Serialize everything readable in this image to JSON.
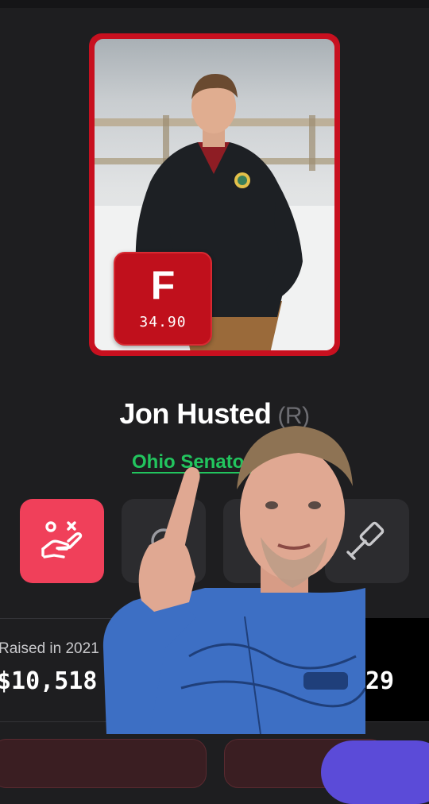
{
  "politician": {
    "name": "Jon Husted",
    "party": "(R)",
    "office": "Ohio Senator",
    "grade": "F",
    "score": "34.90"
  },
  "actions": [
    {
      "icon": "hand-scale-icon",
      "state": "active"
    },
    {
      "icon": "action-icon-2",
      "state": "inactive"
    },
    {
      "icon": "action-icon-3",
      "state": "inactive"
    },
    {
      "icon": "gavel-icon",
      "state": "inactive"
    }
  ],
  "stats": {
    "raised_label": "Raised in 2021",
    "raised_value": "$10,518",
    "right_value": "29"
  },
  "colors": {
    "card_border": "#c8101f",
    "grade_badge": "#c0101c",
    "office_link": "#22c55e",
    "active_tile": "#f0405a",
    "background": "#1e1e20"
  }
}
